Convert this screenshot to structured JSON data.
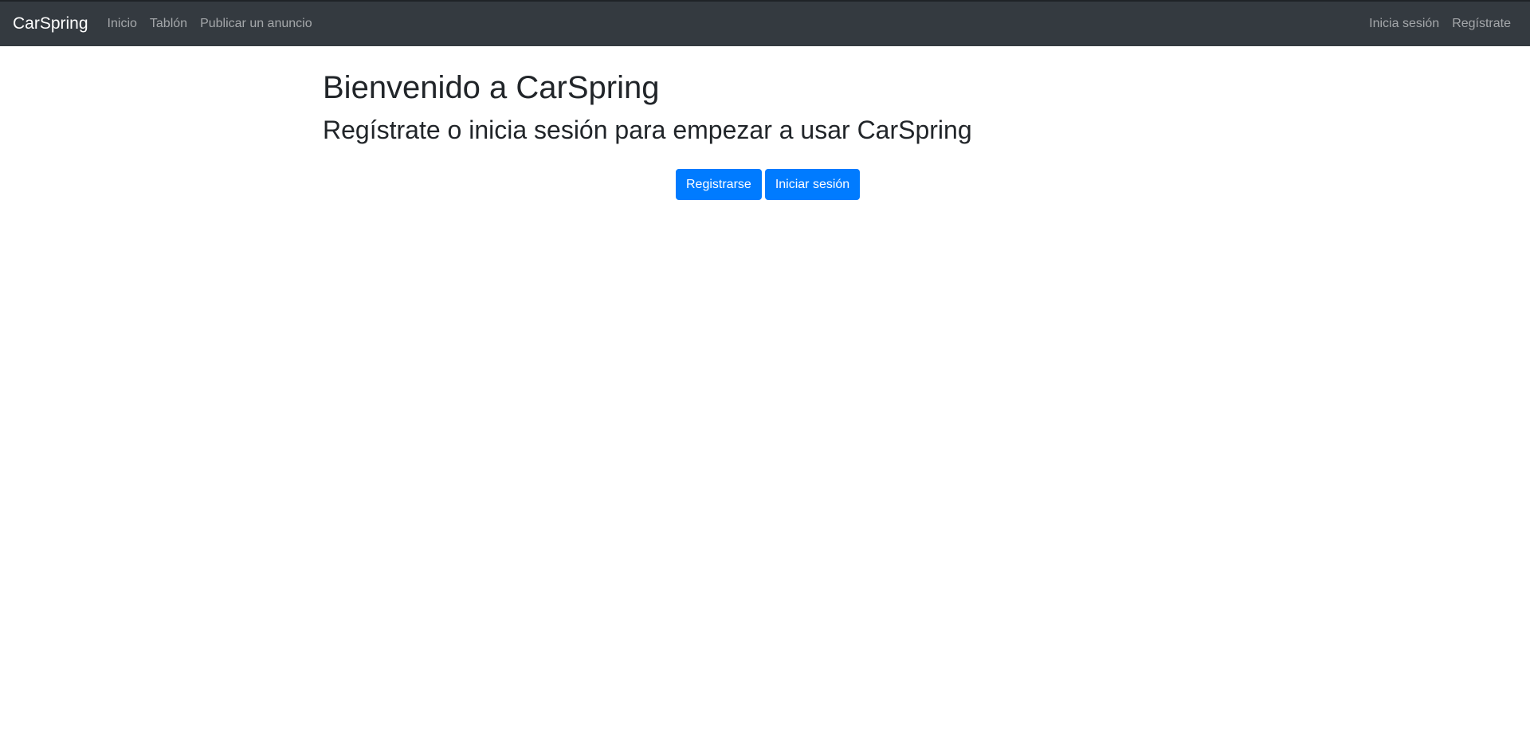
{
  "navbar": {
    "brand": "CarSpring",
    "left_links": [
      "Inicio",
      "Tablón",
      "Publicar un anuncio"
    ],
    "right_links": [
      "Inicia sesión",
      "Regístrate"
    ],
    "background_color": "#343a40"
  },
  "main": {
    "title": "Bienvenido a CarSpring",
    "subtitle": "Regístrate o inicia sesión para empezar a usar CarSpring",
    "buttons": {
      "register_label": "Registrarse",
      "login_label": "Iniciar sesión"
    },
    "button_color": "#007bff"
  }
}
